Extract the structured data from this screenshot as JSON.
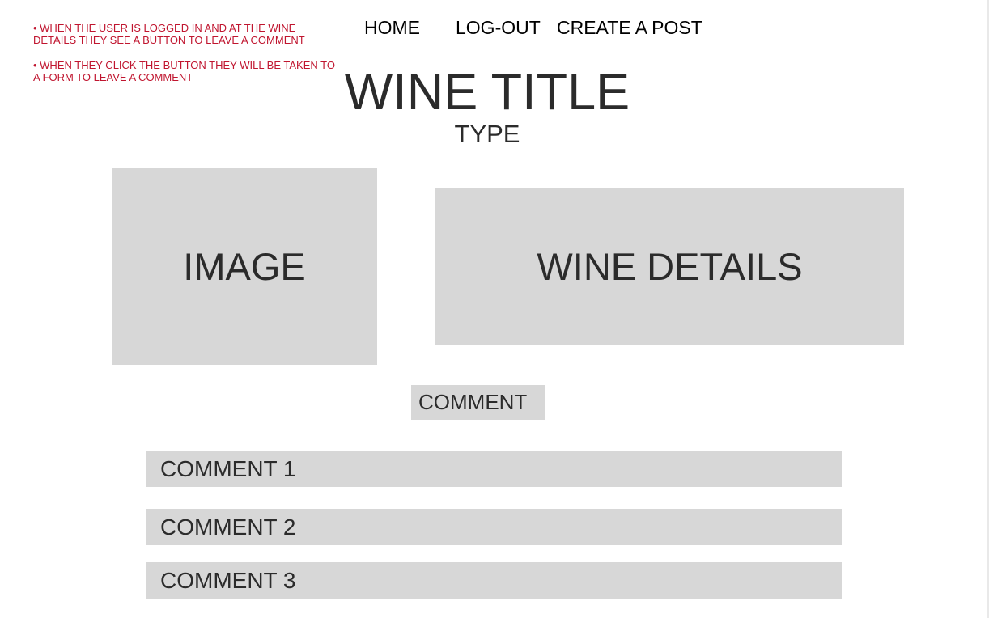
{
  "notes": [
    "• WHEN THE USER IS LOGGED IN AND AT THE WINE DETAILS THEY SEE A BUTTON TO LEAVE A COMMENT",
    "• WHEN THEY CLICK THE BUTTON THEY WILL BE TAKEN TO A FORM TO LEAVE A COMMENT"
  ],
  "nav": {
    "home": "HOME",
    "logout": "LOG-OUT",
    "create_post": "CREATE A POST"
  },
  "wine": {
    "title": "WINE TITLE",
    "type": "TYPE",
    "image_placeholder": "IMAGE",
    "details_placeholder": "WINE DETAILS"
  },
  "comment_button_label": "COMMENT",
  "comments": [
    "COMMENT 1",
    "COMMENT 2",
    "COMMENT 3"
  ],
  "colors": {
    "annotation": "#c0152f",
    "placeholder_fill": "#d7d7d7",
    "text": "#2b2b2b"
  }
}
